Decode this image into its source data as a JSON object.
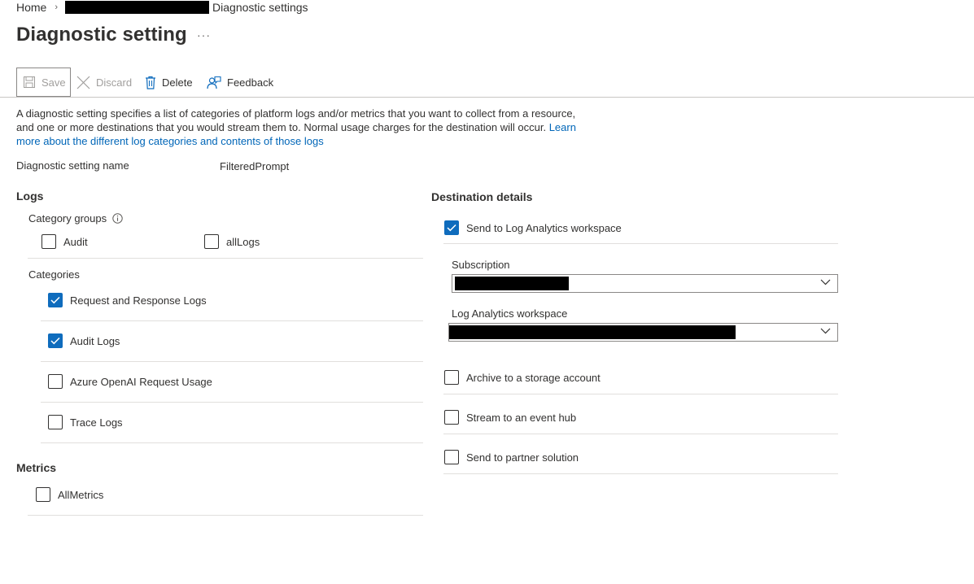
{
  "breadcrumb": {
    "home": "Home",
    "separator": "›",
    "current": "Diagnostic settings"
  },
  "page": {
    "title": "Diagnostic setting",
    "more": "···"
  },
  "toolbar": {
    "save": "Save",
    "discard": "Discard",
    "delete": "Delete",
    "feedback": "Feedback"
  },
  "description": {
    "text": "A diagnostic setting specifies a list of categories of platform logs and/or metrics that you want to collect from a resource, and one or more destinations that you would stream them to. Normal usage charges for the destination will occur. ",
    "link": "Learn more about the different log categories and contents of those logs"
  },
  "setting_name": {
    "label": "Diagnostic setting name",
    "value": "FilteredPrompt"
  },
  "logs": {
    "heading": "Logs",
    "category_groups": {
      "label": "Category groups",
      "items": [
        {
          "label": "Audit",
          "checked": false
        },
        {
          "label": "allLogs",
          "checked": false
        }
      ]
    },
    "categories": {
      "label": "Categories",
      "items": [
        {
          "label": "Request and Response Logs",
          "checked": true
        },
        {
          "label": "Audit Logs",
          "checked": true
        },
        {
          "label": "Azure OpenAI Request Usage",
          "checked": false
        },
        {
          "label": "Trace Logs",
          "checked": false
        }
      ]
    }
  },
  "metrics": {
    "heading": "Metrics",
    "items": [
      {
        "label": "AllMetrics",
        "checked": false
      }
    ]
  },
  "destination": {
    "heading": "Destination details",
    "log_analytics": {
      "label": "Send to Log Analytics workspace",
      "checked": true
    },
    "subscription_label": "Subscription",
    "workspace_label": "Log Analytics workspace",
    "archive": {
      "label": "Archive to a storage account",
      "checked": false
    },
    "event_hub": {
      "label": "Stream to an event hub",
      "checked": false
    },
    "partner": {
      "label": "Send to partner solution",
      "checked": false
    }
  },
  "colors": {
    "accent": "#0f6cbd",
    "link": "#0066b8",
    "text": "#323130",
    "divider": "#e1dfdd"
  },
  "icons": {
    "save": "save-icon",
    "discard": "close-icon",
    "delete": "trash-icon",
    "feedback": "feedback-icon",
    "info": "info-icon",
    "chevron": "chevron-down-icon",
    "check": "checkmark-icon"
  }
}
